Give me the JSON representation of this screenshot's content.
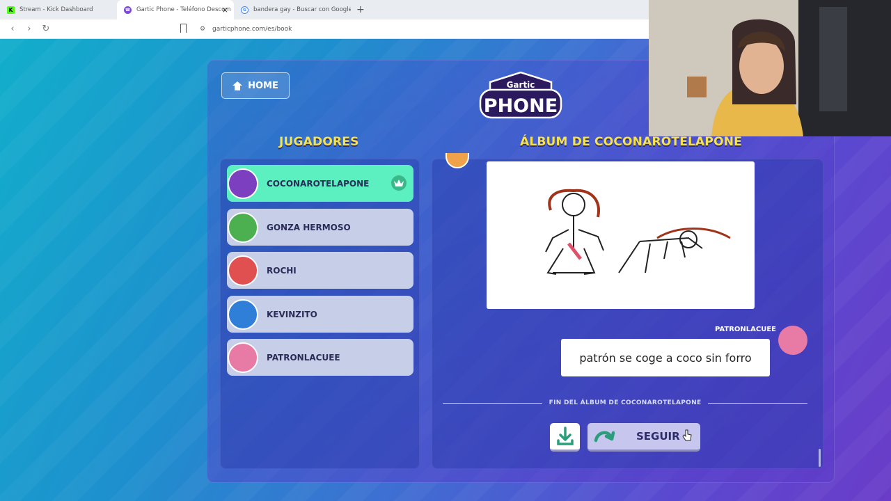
{
  "browser": {
    "tabs": [
      {
        "title": "Stream - Kick Dashboard",
        "icon": "kick-icon"
      },
      {
        "title": "Gartic Phone - Teléfono Descom",
        "icon": "gartic-icon"
      },
      {
        "title": "bandera gay - Buscar con Google",
        "icon": "google-icon"
      }
    ],
    "close_glyph": "×",
    "new_tab_glyph": "+",
    "url": "garticphone.com/es/book"
  },
  "nav": {
    "home_label": "HOME"
  },
  "logo": {
    "line1": "Gartic",
    "line2": "PHONE"
  },
  "headings": {
    "players": "JUGADORES",
    "album": "ÁLBUM DE COCONAROTELAPONE"
  },
  "players": [
    {
      "name": "COCONAROTELAPONE",
      "active": true,
      "host": true,
      "avatar_color": "#7b3fbf"
    },
    {
      "name": "GONZA HERMOSO",
      "active": false,
      "host": false,
      "avatar_color": "#4caf50"
    },
    {
      "name": "ROCHI",
      "active": false,
      "host": false,
      "avatar_color": "#e05050"
    },
    {
      "name": "KEVINZITO",
      "active": false,
      "host": false,
      "avatar_color": "#2f7fd8"
    },
    {
      "name": "PATRONLACUEE",
      "active": false,
      "host": false,
      "avatar_color": "#e87aa6"
    }
  ],
  "album": {
    "guess_author": "PATRONLACUEE",
    "guess_text": "patrón se coge a coco sin forro",
    "end_label": "FIN DEL ÁLBUM DE COCONAROTELAPONE",
    "continue_label": "SEGUIR"
  },
  "colors": {
    "active_player": "#5cf0c0",
    "player": "#c6cee8",
    "heading": "#f6e24a"
  }
}
